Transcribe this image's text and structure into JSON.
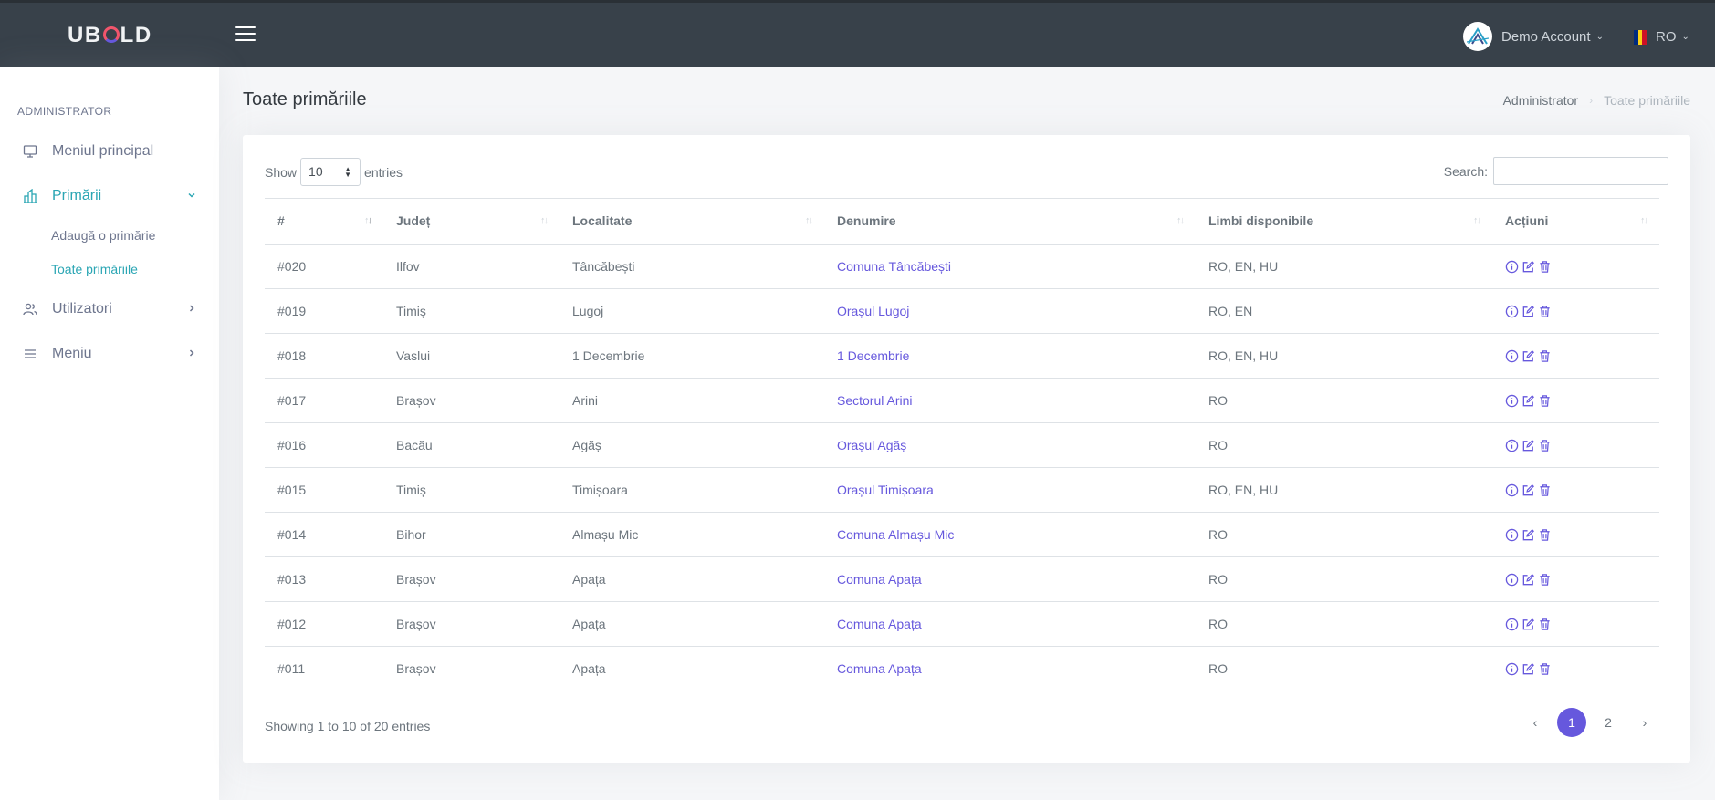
{
  "topbar": {
    "logo_prefix": "UB",
    "logo_suffix": "LD",
    "account_name": "Demo Account",
    "language": "RO",
    "flag_colors": [
      "#002b7f",
      "#fcd116",
      "#ce1126"
    ]
  },
  "sidebar": {
    "section_title": "ADMINISTRATOR",
    "items": [
      {
        "label": "Meniul principal",
        "icon": "monitor-icon"
      },
      {
        "label": "Primării",
        "icon": "building-icon",
        "active": true,
        "expanded": true,
        "children": [
          {
            "label": "Adaugă o primărie"
          },
          {
            "label": "Toate primăriile",
            "active": true
          }
        ]
      },
      {
        "label": "Utilizatori",
        "icon": "users-icon"
      },
      {
        "label": "Meniu",
        "icon": "menu-lines-icon"
      }
    ]
  },
  "page": {
    "title": "Toate primăriile",
    "breadcrumb": [
      "Administrator",
      "Toate primăriile"
    ]
  },
  "table": {
    "show_label": "Show",
    "page_size": "10",
    "entries_label": "entries",
    "search_label": "Search:",
    "search_value": "",
    "columns": [
      "#",
      "Județ",
      "Localitate",
      "Denumire",
      "Limbi disponibile",
      "Acțiuni"
    ],
    "rows": [
      {
        "id": "#020",
        "judet": "Ilfov",
        "localitate": "Tâncăbești",
        "denumire": "Comuna Tâncăbești",
        "limbi": "RO, EN, HU"
      },
      {
        "id": "#019",
        "judet": "Timiș",
        "localitate": "Lugoj",
        "denumire": "Orașul Lugoj",
        "limbi": "RO, EN"
      },
      {
        "id": "#018",
        "judet": "Vaslui",
        "localitate": "1 Decembrie",
        "denumire": "1 Decembrie",
        "limbi": "RO, EN, HU"
      },
      {
        "id": "#017",
        "judet": "Brașov",
        "localitate": "Arini",
        "denumire": "Sectorul Arini",
        "limbi": "RO"
      },
      {
        "id": "#016",
        "judet": "Bacău",
        "localitate": "Agăș",
        "denumire": "Orașul Agăș",
        "limbi": "RO"
      },
      {
        "id": "#015",
        "judet": "Timiș",
        "localitate": "Timișoara",
        "denumire": "Orașul Timișoara",
        "limbi": "RO, EN, HU"
      },
      {
        "id": "#014",
        "judet": "Bihor",
        "localitate": "Almașu Mic",
        "denumire": "Comuna Almașu Mic",
        "limbi": "RO"
      },
      {
        "id": "#013",
        "judet": "Brașov",
        "localitate": "Apața",
        "denumire": "Comuna Apața",
        "limbi": "RO"
      },
      {
        "id": "#012",
        "judet": "Brașov",
        "localitate": "Apața",
        "denumire": "Comuna Apața",
        "limbi": "RO"
      },
      {
        "id": "#011",
        "judet": "Brașov",
        "localitate": "Apața",
        "denumire": "Comuna Apața",
        "limbi": "RO"
      }
    ],
    "info": "Showing 1 to 10 of 20 entries",
    "pagination": {
      "prev": "‹",
      "pages": [
        "1",
        "2"
      ],
      "current": "1",
      "next": "›"
    }
  },
  "colors": {
    "topbar": "#38414a",
    "accent": "#2ba6b4",
    "link": "#6658dd"
  }
}
